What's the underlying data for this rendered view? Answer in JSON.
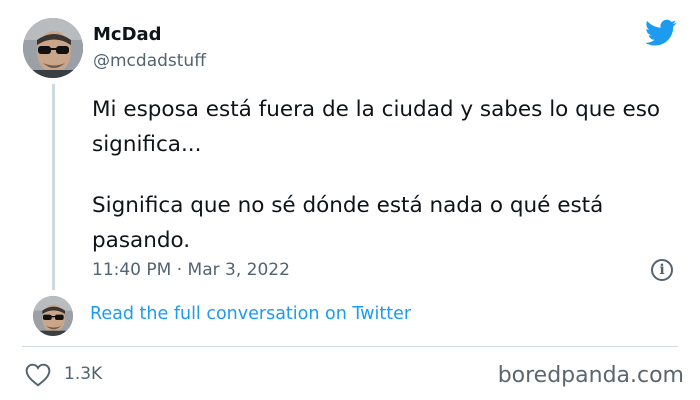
{
  "tweet": {
    "author": {
      "name": "McDad",
      "handle": "@mcdadstuff"
    },
    "body": [
      "Mi esposa está fuera de la ciudad y sabes lo que eso significa...",
      "Significa que no sé dónde está nada o qué está pasando."
    ],
    "timestamp": "11:40 PM · Mar 3, 2022",
    "conversation_link": "Read the full conversation on Twitter",
    "likes": "1.3K"
  },
  "watermark": "boredpanda.com",
  "icons": {
    "brand": "twitter-bird-icon",
    "info": "info-icon",
    "like": "heart-icon"
  },
  "colors": {
    "link": "#1d9bf0",
    "brand": "#1d9bf0",
    "muted": "#536471",
    "text": "#0f1419"
  }
}
